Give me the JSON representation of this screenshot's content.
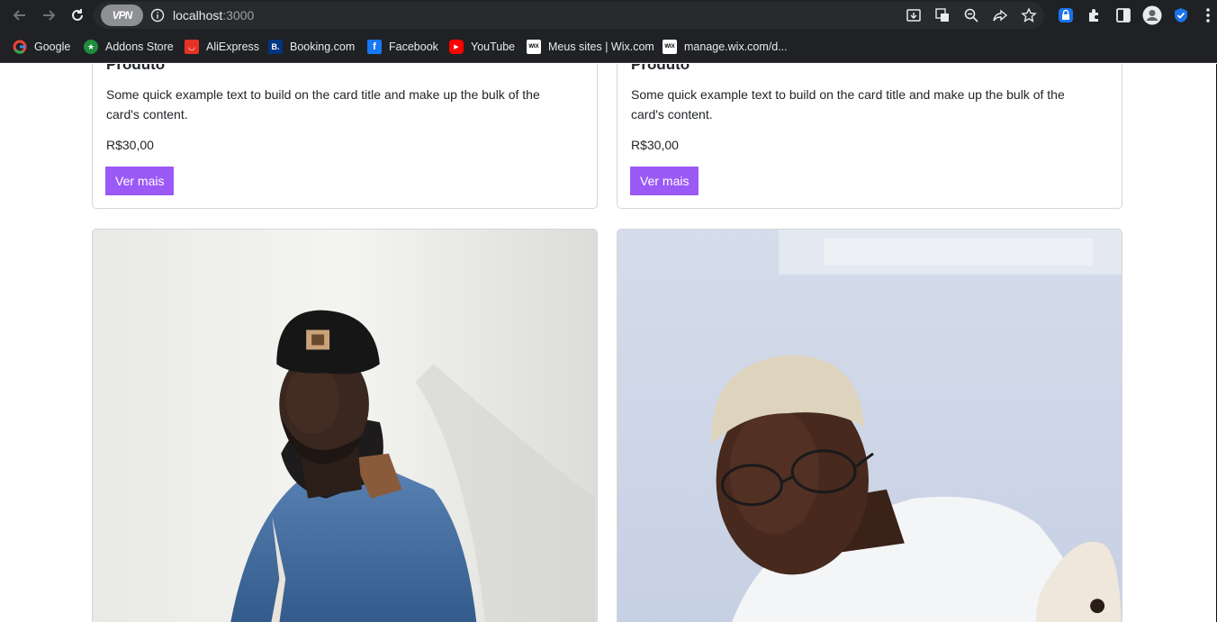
{
  "browser": {
    "vpn_label": "VPN",
    "url_host": "localhost",
    "url_port": ":3000",
    "bookmarks": [
      {
        "label": "Google",
        "icon": "google-icon"
      },
      {
        "label": "Addons Store",
        "icon": "addons-store-icon"
      },
      {
        "label": "AliExpress",
        "icon": "aliexpress-icon"
      },
      {
        "label": "Booking.com",
        "icon": "booking-icon"
      },
      {
        "label": "Facebook",
        "icon": "facebook-icon"
      },
      {
        "label": "YouTube",
        "icon": "youtube-icon"
      },
      {
        "label": "Meus sites | Wix.com",
        "icon": "wix-icon"
      },
      {
        "label": "manage.wix.com/d...",
        "icon": "wix-icon"
      }
    ]
  },
  "products": [
    {
      "title": "Produto",
      "text": "Some quick example text to build on the card title and make up the bulk of the card's content.",
      "price": "R$30,00",
      "button": "Ver mais"
    },
    {
      "title": "Produto",
      "text": "Some quick example text to build on the card title and make up the bulk of the card's content.",
      "price": "R$30,00",
      "button": "Ver mais"
    }
  ],
  "colors": {
    "chrome_bg": "#202124",
    "button_purple": "#9b59f6"
  }
}
